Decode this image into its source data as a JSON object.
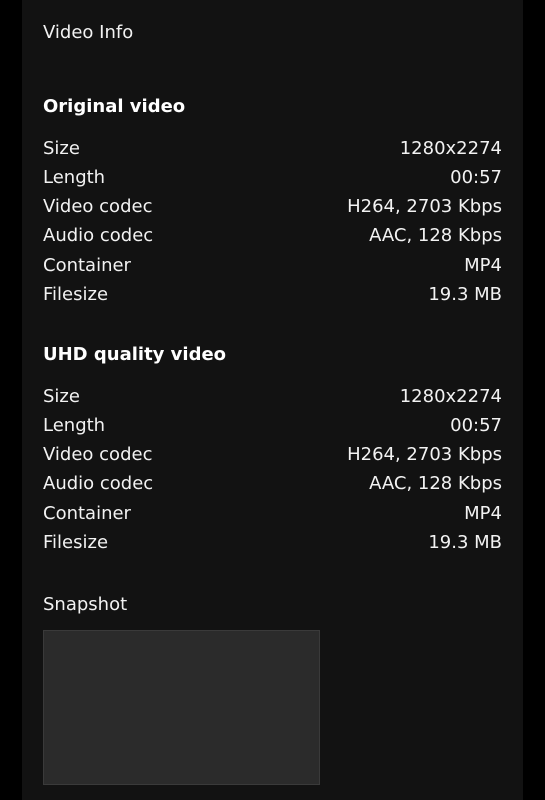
{
  "panel": {
    "title": "Video Info"
  },
  "original": {
    "heading": "Original video",
    "rows": [
      {
        "label": "Size",
        "value": "1280x2274"
      },
      {
        "label": "Length",
        "value": "00:57"
      },
      {
        "label": "Video codec",
        "value": "H264, 2703 Kbps"
      },
      {
        "label": "Audio codec",
        "value": "AAC, 128 Kbps"
      },
      {
        "label": "Container",
        "value": "MP4"
      },
      {
        "label": "Filesize",
        "value": "19.3 MB"
      }
    ]
  },
  "uhd": {
    "heading": "UHD quality video",
    "rows": [
      {
        "label": "Size",
        "value": "1280x2274"
      },
      {
        "label": "Length",
        "value": "00:57"
      },
      {
        "label": "Video codec",
        "value": "H264, 2703 Kbps"
      },
      {
        "label": "Audio codec",
        "value": "AAC, 128 Kbps"
      },
      {
        "label": "Container",
        "value": "MP4"
      },
      {
        "label": "Filesize",
        "value": "19.3 MB"
      }
    ]
  },
  "snapshot": {
    "label": "Snapshot"
  }
}
